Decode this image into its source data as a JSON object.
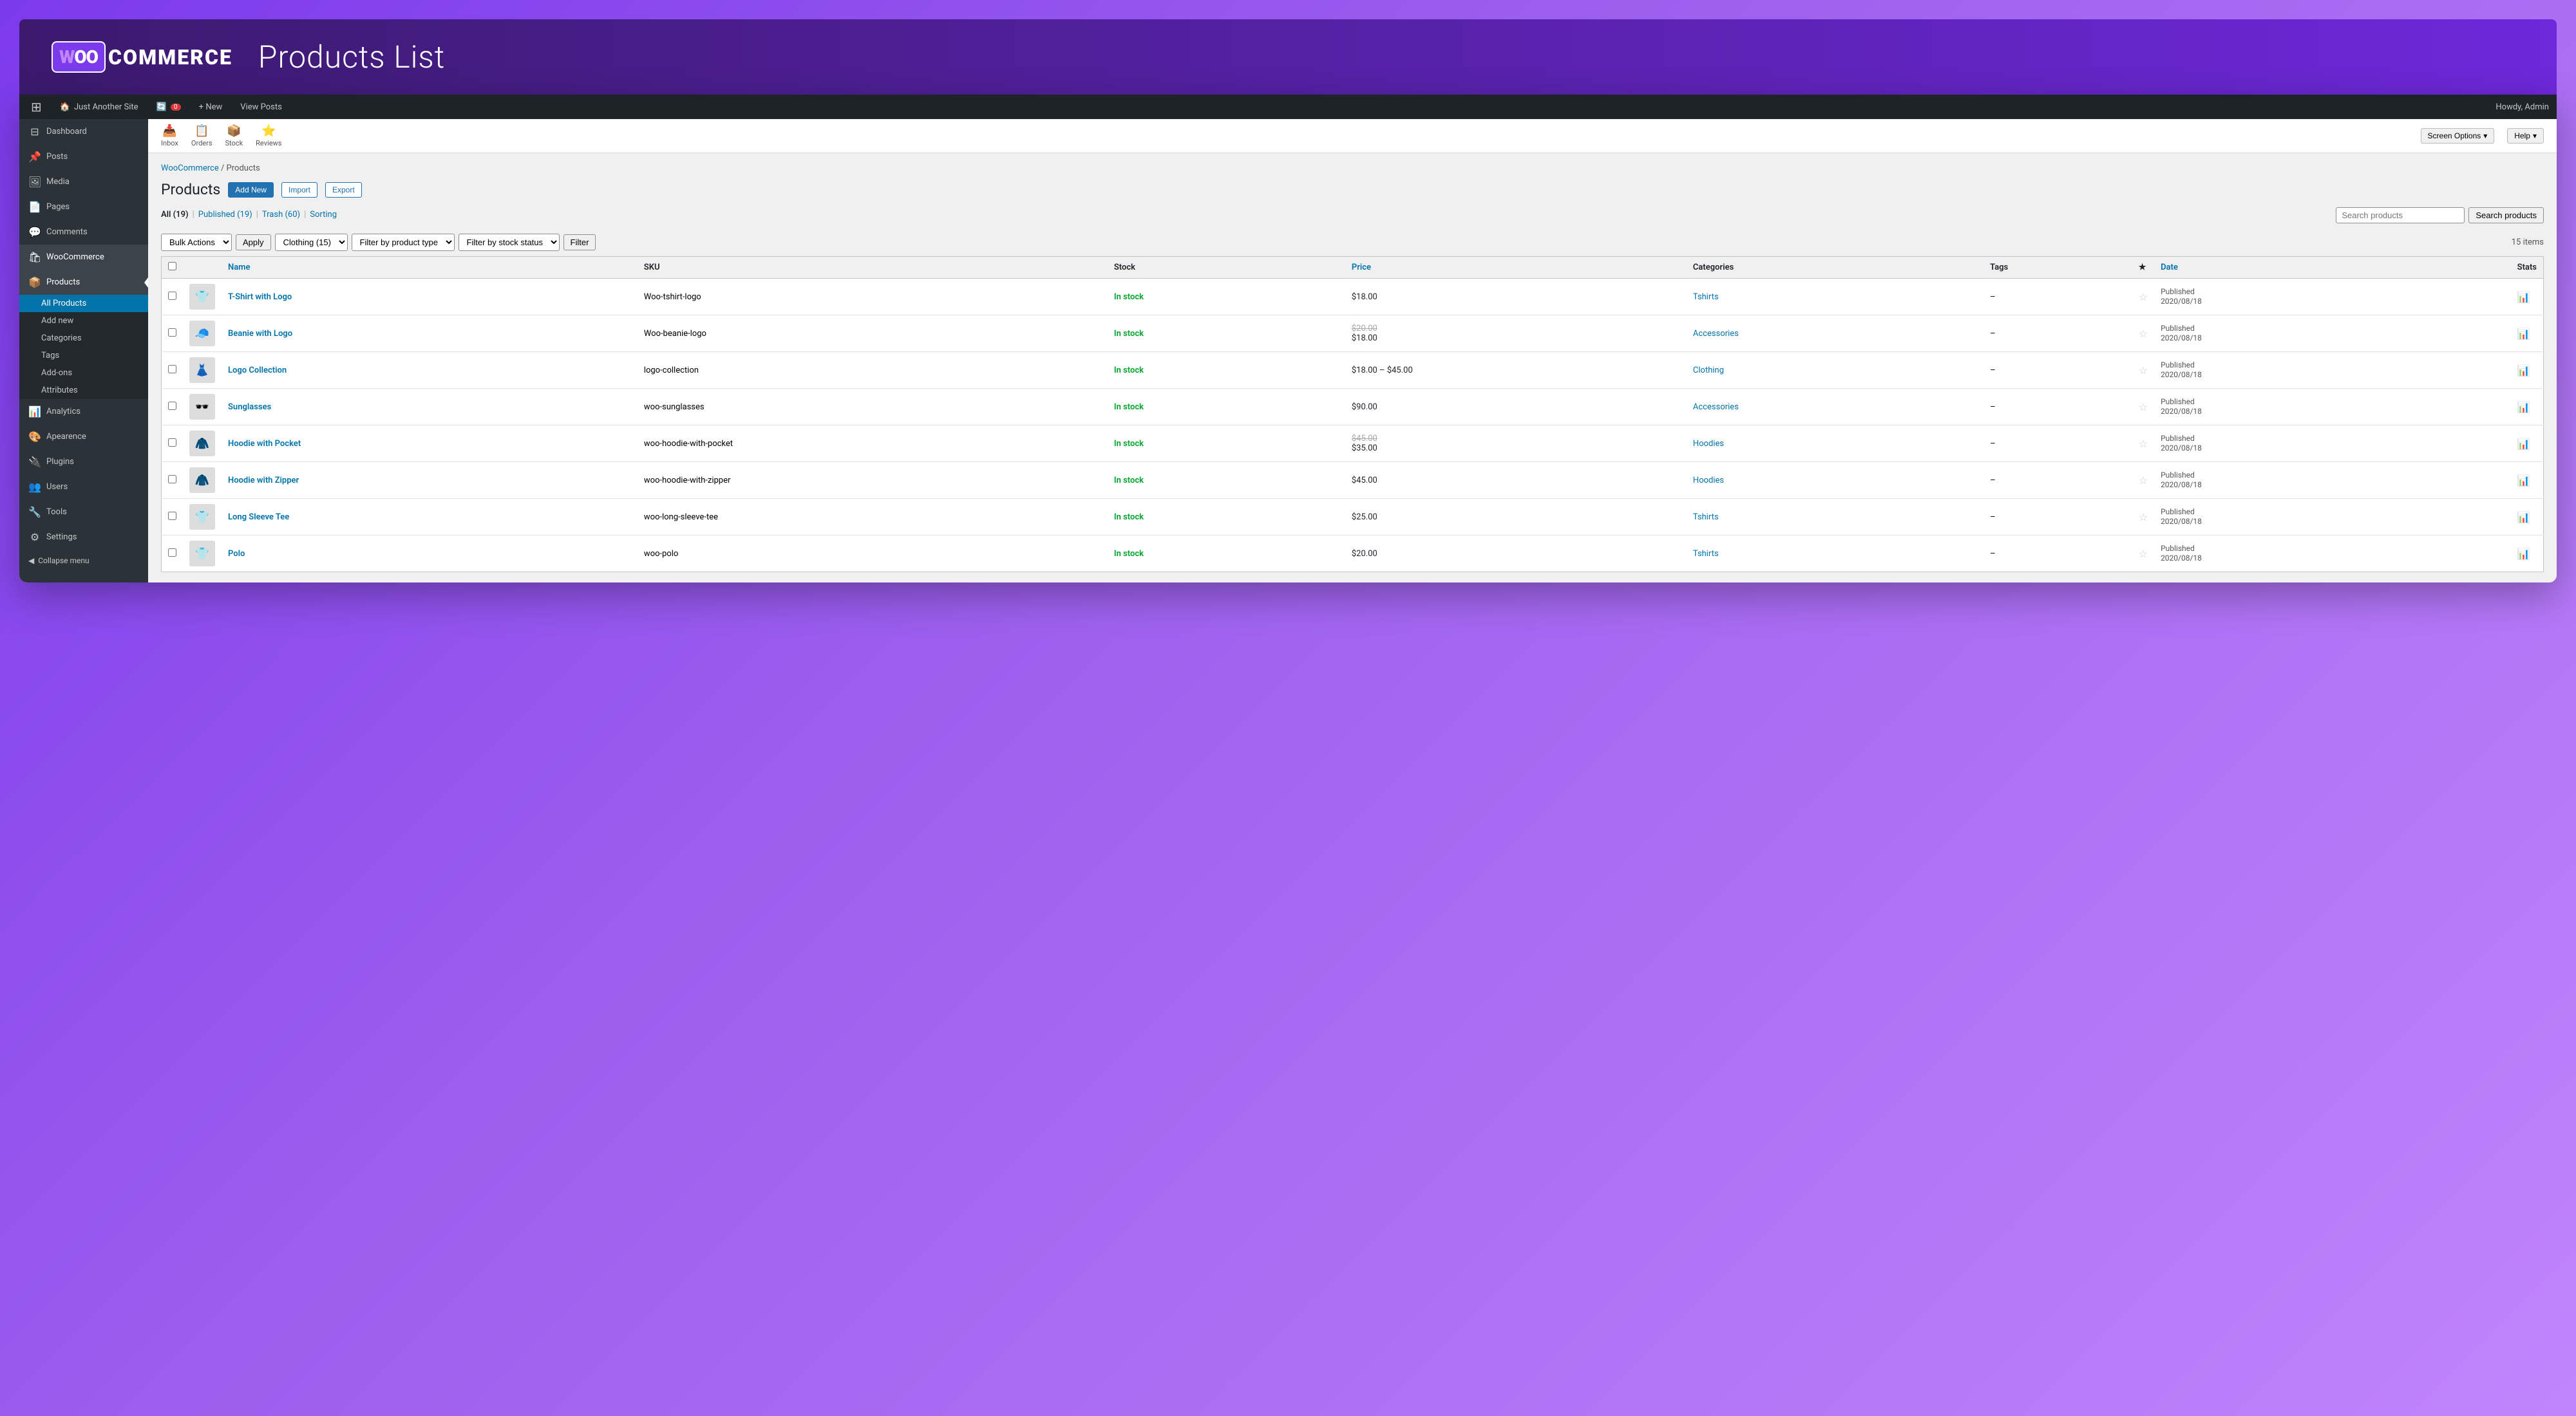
{
  "header": {
    "logo_woo": "WOO",
    "logo_commerce": "COMMERCE",
    "page_title": "Products List"
  },
  "admin_bar": {
    "wp_icon": "⊞",
    "site_name": "Just Another Site",
    "updates_count": "0",
    "new_label": "+ New",
    "view_posts": "View Posts",
    "howdy": "Howdy, Admin"
  },
  "quick_access": {
    "inbox_label": "Inbox",
    "orders_label": "Orders",
    "stock_label": "Stock",
    "reviews_label": "Reviews",
    "screen_options": "Screen Options",
    "help": "Help"
  },
  "sidebar": {
    "dashboard": "Dashboard",
    "posts": "Posts",
    "media": "Media",
    "pages": "Pages",
    "comments": "Comments",
    "woocommerce": "WooCommerce",
    "products": "Products",
    "products_sub": {
      "all_products": "All Products",
      "add_new": "Add new",
      "categories": "Categories",
      "tags": "Tags",
      "add_ons": "Add-ons",
      "attributes": "Attributes"
    },
    "analytics": "Analytics",
    "appearance": "Apearence",
    "plugins": "Plugins",
    "users": "Users",
    "tools": "Tools",
    "settings": "Settings",
    "collapse": "Collapse menu"
  },
  "breadcrumb": {
    "woocommerce": "WooCommerce",
    "separator": "/",
    "products": "Products"
  },
  "page": {
    "title": "Products",
    "add_new_btn": "Add New",
    "import_btn": "Import",
    "export_btn": "Export"
  },
  "filter_tabs": [
    {
      "label": "All (19)",
      "key": "all",
      "active": false
    },
    {
      "label": "Published (19)",
      "key": "published",
      "active": false
    },
    {
      "label": "Trash (60)",
      "key": "trash",
      "active": false
    },
    {
      "label": "Sorting",
      "key": "sorting",
      "active": false
    }
  ],
  "search": {
    "placeholder": "Search products",
    "button": "Search products"
  },
  "filters": {
    "bulk_actions": "Bulk Actions",
    "apply": "Apply",
    "clothing": "Clothing (15)",
    "filter_product_type": "Filter by product type",
    "filter_stock_status": "Filter by stock status",
    "filter_btn": "Filter",
    "items_count": "15 items"
  },
  "table": {
    "columns": [
      "",
      "",
      "Name",
      "SKU",
      "Stock",
      "Price",
      "Categories",
      "Tags",
      "★",
      "Date",
      "Stats"
    ],
    "rows": [
      {
        "id": 1,
        "thumb_emoji": "👕",
        "name": "T-Shirt with Logo",
        "sku": "Woo-tshirt-logo",
        "stock": "In stock",
        "price": "$18.00",
        "price_old": "",
        "category": "Tshirts",
        "tags": "–",
        "date": "Published\n2020/08/18"
      },
      {
        "id": 2,
        "thumb_emoji": "🧢",
        "name": "Beanie with Logo",
        "sku": "Woo-beanie-logo",
        "stock": "In stock",
        "price": "$18.00",
        "price_old": "$20.00",
        "category": "Accessories",
        "tags": "–",
        "date": "Published\n2020/08/18"
      },
      {
        "id": 3,
        "thumb_emoji": "👗",
        "name": "Logo Collection",
        "sku": "logo-collection",
        "stock": "In stock",
        "price": "$18.00 – $45.00",
        "price_old": "",
        "category": "Clothing",
        "tags": "–",
        "date": "Published\n2020/08/18"
      },
      {
        "id": 4,
        "thumb_emoji": "🕶️",
        "name": "Sunglasses",
        "sku": "woo-sunglasses",
        "stock": "In stock",
        "price": "$90.00",
        "price_old": "",
        "category": "Accessories",
        "tags": "–",
        "date": "Published\n2020/08/18"
      },
      {
        "id": 5,
        "thumb_emoji": "🧥",
        "name": "Hoodie with Pocket",
        "sku": "woo-hoodie-with-pocket",
        "stock": "In stock",
        "price": "$35.00",
        "price_old": "$45.00",
        "category": "Hoodies",
        "tags": "–",
        "date": "Published\n2020/08/18"
      },
      {
        "id": 6,
        "thumb_emoji": "🧥",
        "name": "Hoodie with Zipper",
        "sku": "woo-hoodie-with-zipper",
        "stock": "In stock",
        "price": "$45.00",
        "price_old": "",
        "category": "Hoodies",
        "tags": "–",
        "date": "Published\n2020/08/18"
      },
      {
        "id": 7,
        "thumb_emoji": "👕",
        "name": "Long Sleeve Tee",
        "sku": "woo-long-sleeve-tee",
        "stock": "In stock",
        "price": "$25.00",
        "price_old": "",
        "category": "Tshirts",
        "tags": "–",
        "date": "Published\n2020/08/18"
      },
      {
        "id": 8,
        "thumb_emoji": "👕",
        "name": "Polo",
        "sku": "woo-polo",
        "stock": "In stock",
        "price": "$20.00",
        "price_old": "",
        "category": "Tshirts",
        "tags": "–",
        "date": "Published\n2020/08/18"
      }
    ]
  }
}
